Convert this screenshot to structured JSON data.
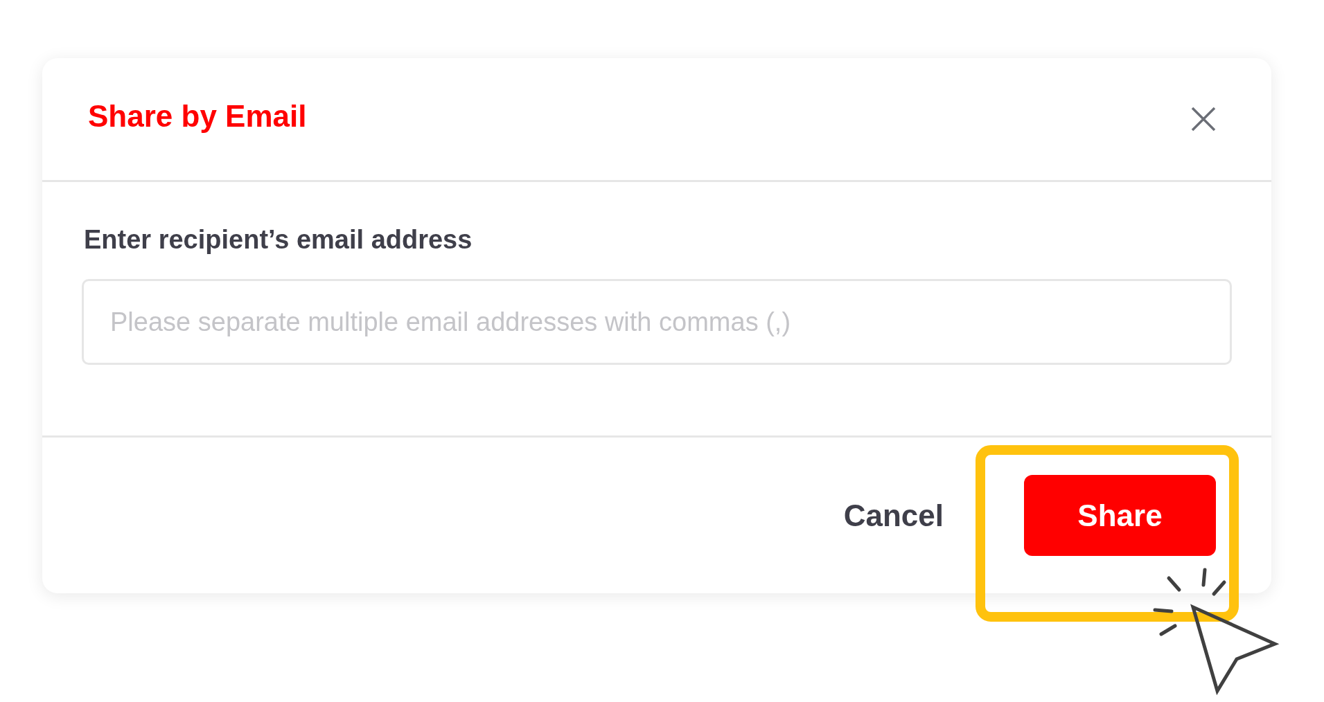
{
  "dialog": {
    "title": "Share by Email",
    "field": {
      "label": "Enter recipient’s email address",
      "placeholder": "Please separate multiple email addresses with commas (,)"
    },
    "buttons": [
      {
        "label": "Cancel",
        "kind": "text"
      },
      {
        "label": "Share",
        "kind": "primary"
      }
    ]
  }
}
